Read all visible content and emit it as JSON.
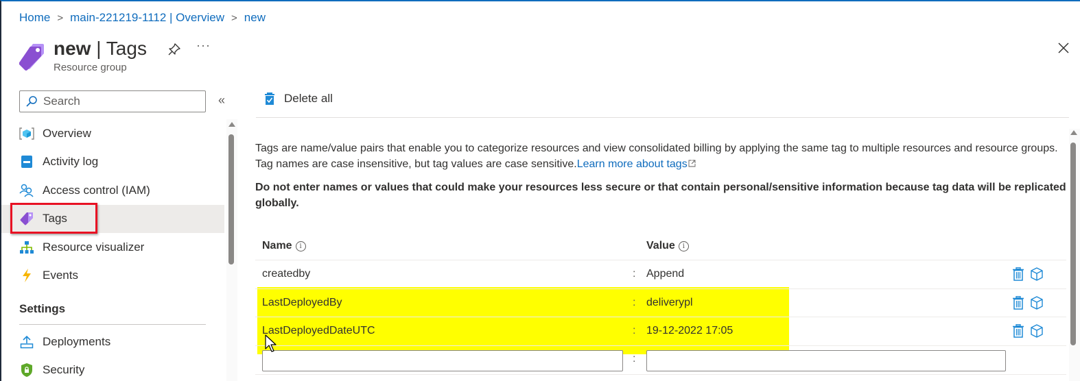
{
  "breadcrumb": {
    "items": [
      "Home",
      "main-221219-1112 | Overview",
      "new"
    ],
    "separator": ">"
  },
  "header": {
    "title_resource": "new",
    "title_separator": " | ",
    "title_blade": "Tags",
    "subtitle": "Resource group",
    "more_label": "···"
  },
  "sidebar": {
    "search_placeholder": "Search",
    "collapse_label": "«",
    "items": [
      {
        "label": "Overview",
        "icon": "overview-cube-icon"
      },
      {
        "label": "Activity log",
        "icon": "activity-log-icon"
      },
      {
        "label": "Access control (IAM)",
        "icon": "people-icon"
      },
      {
        "label": "Tags",
        "icon": "tag-icon",
        "active": true
      },
      {
        "label": "Resource visualizer",
        "icon": "hierarchy-icon"
      },
      {
        "label": "Events",
        "icon": "lightning-icon"
      }
    ],
    "section_settings": "Settings",
    "settings_items": [
      {
        "label": "Deployments",
        "icon": "upload-icon"
      },
      {
        "label": "Security",
        "icon": "shield-lock-icon"
      }
    ]
  },
  "toolbar": {
    "delete_all_label": "Delete all"
  },
  "content": {
    "description": "Tags are name/value pairs that enable you to categorize resources and view consolidated billing by applying the same tag to multiple resources and resource groups. Tag names are case insensitive, but tag values are case sensitive.",
    "learn_more_label": "Learn more about tags",
    "warning": "Do not enter names or values that could make your resources less secure or that contain personal/sensitive information because tag data will be replicated globally."
  },
  "grid": {
    "name_header": "Name",
    "value_header": "Value",
    "info_glyph": "i",
    "separator": ":",
    "rows": [
      {
        "name": "createdby",
        "value": "Append"
      },
      {
        "name": "LastDeployedBy",
        "value": "deliverypl"
      },
      {
        "name": "LastDeployedDateUTC",
        "value": "19-12-2022 17:05"
      }
    ],
    "new_row": {
      "name_value": "",
      "value_value": ""
    }
  },
  "colors": {
    "accent": "#0f6cbd",
    "highlight": "#ffff00",
    "selection_box": "#e81123",
    "tag_purple": "#8a4fd1"
  }
}
